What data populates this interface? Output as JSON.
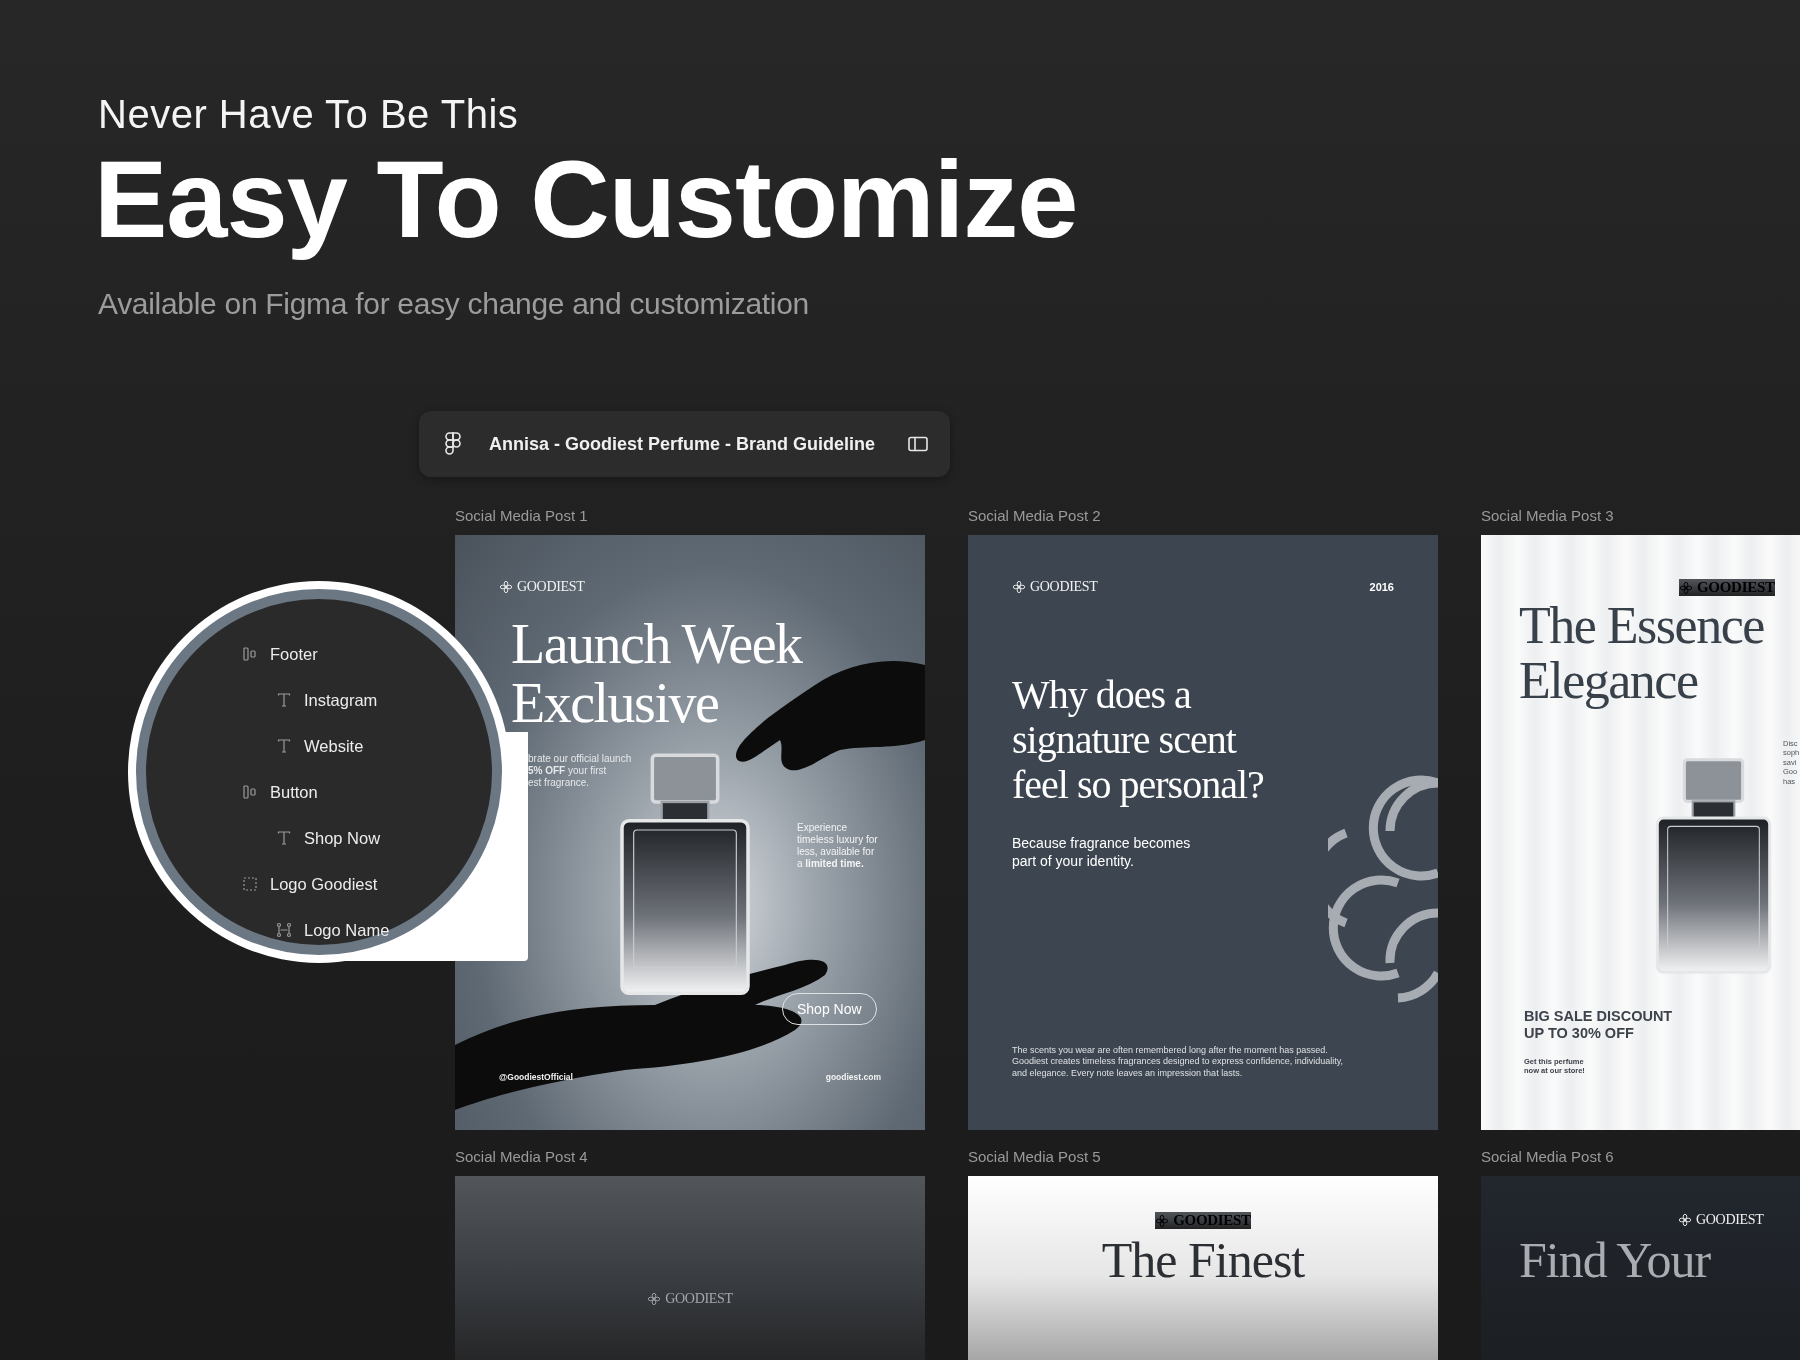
{
  "hero": {
    "eyebrow": "Never Have To Be This",
    "title": "Easy To Customize",
    "subtitle": "Available on Figma for easy change and customization"
  },
  "file_bar": {
    "title": "Annisa - Goodiest Perfume - Brand Guideline"
  },
  "layers": [
    {
      "name": "Footer",
      "kind": "frame",
      "children": [
        {
          "name": "Instagram",
          "kind": "text"
        },
        {
          "name": "Website",
          "kind": "text"
        }
      ]
    },
    {
      "name": "Button",
      "kind": "frame",
      "children": [
        {
          "name": "Shop Now",
          "kind": "text"
        }
      ]
    },
    {
      "name": "Logo Goodiest",
      "kind": "group",
      "children": [
        {
          "name": "Logo Name",
          "kind": "vector"
        }
      ]
    }
  ],
  "posts": [
    {
      "label": "Social Media Post 1",
      "kind": "launch",
      "logo": "GOODIEST",
      "headline": [
        "Launch Week",
        "Exclusive"
      ],
      "promo": [
        "brate our official launch",
        "**5% OFF** your first",
        "est fragrance."
      ],
      "note": [
        "Experience",
        "timeless luxury for",
        "less, available for",
        "a **limited time.**"
      ],
      "button": "Shop Now",
      "handle": "@GoodiestOfficial",
      "website": "goodiest.com"
    },
    {
      "label": "Social Media Post 2",
      "kind": "question",
      "logo": "GOODIEST",
      "year": "2016",
      "headline": [
        "Why does a",
        "signature scent",
        "feel so personal?"
      ],
      "subhead": [
        "Because fragrance becomes",
        "part of your identity."
      ],
      "body": "The scents you wear are often remembered long after the moment has passed. Goodiest creates timeless fragrances designed to express confidence, individuality, and elegance. Every note leaves an impression that lasts."
    },
    {
      "label": "Social Media Post 3",
      "kind": "essence",
      "logo": "GOODIEST",
      "headline": [
        "The Essence",
        "Elegance"
      ],
      "side": [
        "Disc",
        "soph",
        "savi",
        "Goo",
        "has"
      ],
      "sale": [
        "BIG SALE DISCOUNT",
        "UP TO 30% OFF"
      ],
      "cta": [
        "Get this perfume",
        "now at our store!"
      ]
    },
    {
      "label": "Social Media Post 4",
      "kind": "dark",
      "logo": "GOODIEST"
    },
    {
      "label": "Social Media Post 5",
      "kind": "light",
      "logo": "GOODIEST",
      "headline": [
        "The Finest"
      ]
    },
    {
      "label": "Social Media Post 6",
      "kind": "night",
      "logo": "GOODIEST",
      "headline": [
        "Find Your"
      ]
    }
  ]
}
